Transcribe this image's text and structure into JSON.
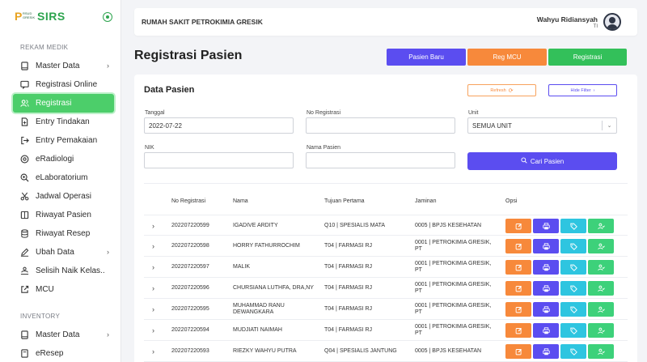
{
  "brand": {
    "name": "SIRS",
    "logo_text": "RSUD GRESIK"
  },
  "sidebar": {
    "section_rekam_medik": "REKAM MEDIK",
    "section_inventory": "INVENTORY",
    "items": [
      {
        "label": "Master Data",
        "icon": "monitor-icon",
        "chevron": "›"
      },
      {
        "label": "Registrasi Online",
        "icon": "chat-icon"
      },
      {
        "label": "Registrasi",
        "icon": "users-icon",
        "active": true
      },
      {
        "label": "Entry Tindakan",
        "icon": "document-plus-icon"
      },
      {
        "label": "Entry Pemakaian",
        "icon": "logout-icon"
      },
      {
        "label": "eRadiologi",
        "icon": "target-icon"
      },
      {
        "label": "eLaboratorium",
        "icon": "zoom-icon"
      },
      {
        "label": "Jadwal Operasi",
        "icon": "scissors-icon"
      },
      {
        "label": "Riwayat Pasien",
        "icon": "book-icon"
      },
      {
        "label": "Riwayat Resep",
        "icon": "database-icon"
      },
      {
        "label": "Ubah Data",
        "icon": "edit-icon",
        "chevron": "›"
      },
      {
        "label": "Selisih Naik Kelas..",
        "icon": "upload-icon"
      },
      {
        "label": "MCU",
        "icon": "external-icon"
      }
    ],
    "inventory_items": [
      {
        "label": "Master Data",
        "icon": "monitor-icon",
        "chevron": "›"
      },
      {
        "label": "eResep",
        "icon": "receipt-icon"
      }
    ]
  },
  "topbar": {
    "hospital": "RUMAH SAKIT PETROKIMIA GRESIK",
    "user_name": "Wahyu Ridiansyah",
    "user_role": "TI"
  },
  "page": {
    "title": "Registrasi Pasien"
  },
  "actions": {
    "pasien_baru": "Pasien Baru",
    "reg_mcu": "Reg MCU",
    "registrasi": "Registrasi"
  },
  "card": {
    "title": "Data Pasien",
    "refresh_label": "Refresh",
    "hide_filter_label": "Hide Filter",
    "filters": {
      "tanggal_label": "Tanggal",
      "tanggal_value": "2022-07-22",
      "no_registrasi_label": "No Registrasi",
      "no_registrasi_value": "",
      "unit_label": "Unit",
      "unit_value": "SEMUA UNIT",
      "nik_label": "NIK",
      "nik_value": "",
      "nama_pasien_label": "Nama Pasien",
      "nama_pasien_value": ""
    },
    "search_label": "Cari Pasien"
  },
  "table": {
    "headers": {
      "no_registrasi": "No Registrasi",
      "nama": "Nama",
      "tujuan": "Tujuan Pertama",
      "jaminan": "Jaminan",
      "opsi": "Opsi"
    },
    "rows": [
      {
        "no": "202207220599",
        "nama": "IGADIVE ARDITY",
        "tujuan": "Q10 | SPESIALIS MATA",
        "jaminan": "0005 | BPJS KESEHATAN"
      },
      {
        "no": "202207220598",
        "nama": "HORRY FATHURROCHIM",
        "tujuan": "T04 | FARMASI RJ",
        "jaminan": "0001 | PETROKIMIA GRESIK, PT"
      },
      {
        "no": "202207220597",
        "nama": "MALIK",
        "tujuan": "T04 | FARMASI RJ",
        "jaminan": "0001 | PETROKIMIA GRESIK, PT"
      },
      {
        "no": "202207220596",
        "nama": "CHURSIANA LUTHFA, DRA,NY",
        "tujuan": "T04 | FARMASI RJ",
        "jaminan": "0001 | PETROKIMIA GRESIK, PT"
      },
      {
        "no": "202207220595",
        "nama": "MUHAMMAD RANU DEWANGKARA",
        "tujuan": "T04 | FARMASI RJ",
        "jaminan": "0001 | PETROKIMIA GRESIK, PT"
      },
      {
        "no": "202207220594",
        "nama": "MUDJIATI NAIMAH",
        "tujuan": "T04 | FARMASI RJ",
        "jaminan": "0001 | PETROKIMIA GRESIK, PT"
      },
      {
        "no": "202207220593",
        "nama": "RIEZKY WAHYU PUTRA",
        "tujuan": "Q04 | SPESIALIS JANTUNG",
        "jaminan": "0005 | BPJS KESEHATAN"
      }
    ],
    "option_icons": [
      "edit-icon",
      "printer-icon",
      "tag-icon",
      "user-check-icon"
    ]
  },
  "colors": {
    "green": "#4cce6a",
    "purple": "#5b4df0",
    "orange": "#f7893b",
    "cyan": "#2ec5e0",
    "teal": "#3dd17a",
    "registrasi": "#33c05a"
  }
}
